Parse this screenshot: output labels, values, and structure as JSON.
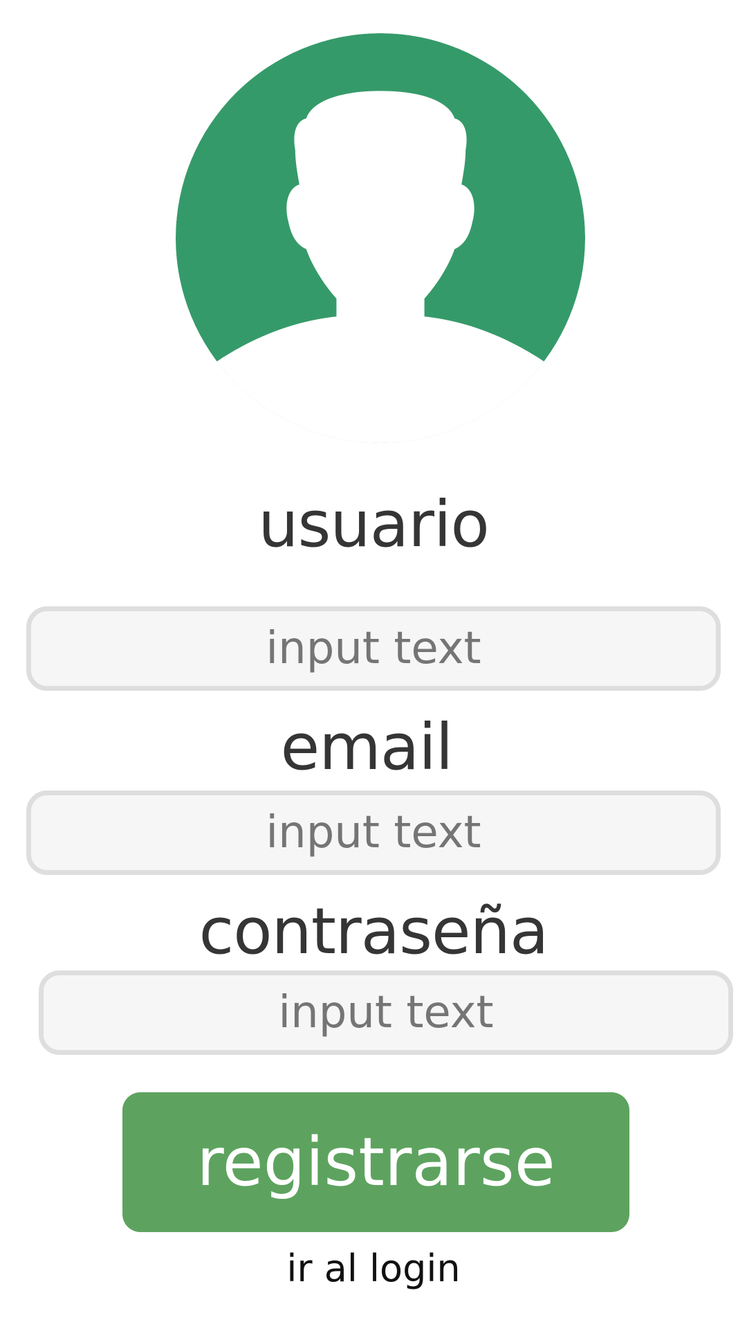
{
  "avatar": {
    "icon": "user-silhouette-icon",
    "circle_color": "#359a69",
    "figure_color": "#ffffff"
  },
  "form": {
    "username": {
      "label": "usuario",
      "placeholder": "input text"
    },
    "email": {
      "label": "email",
      "placeholder": "input text"
    },
    "password": {
      "label": "contraseña",
      "placeholder": "input text"
    }
  },
  "actions": {
    "register_label": "registrarse",
    "register_color": "#5da35f",
    "login_link_label": "ir al login"
  }
}
